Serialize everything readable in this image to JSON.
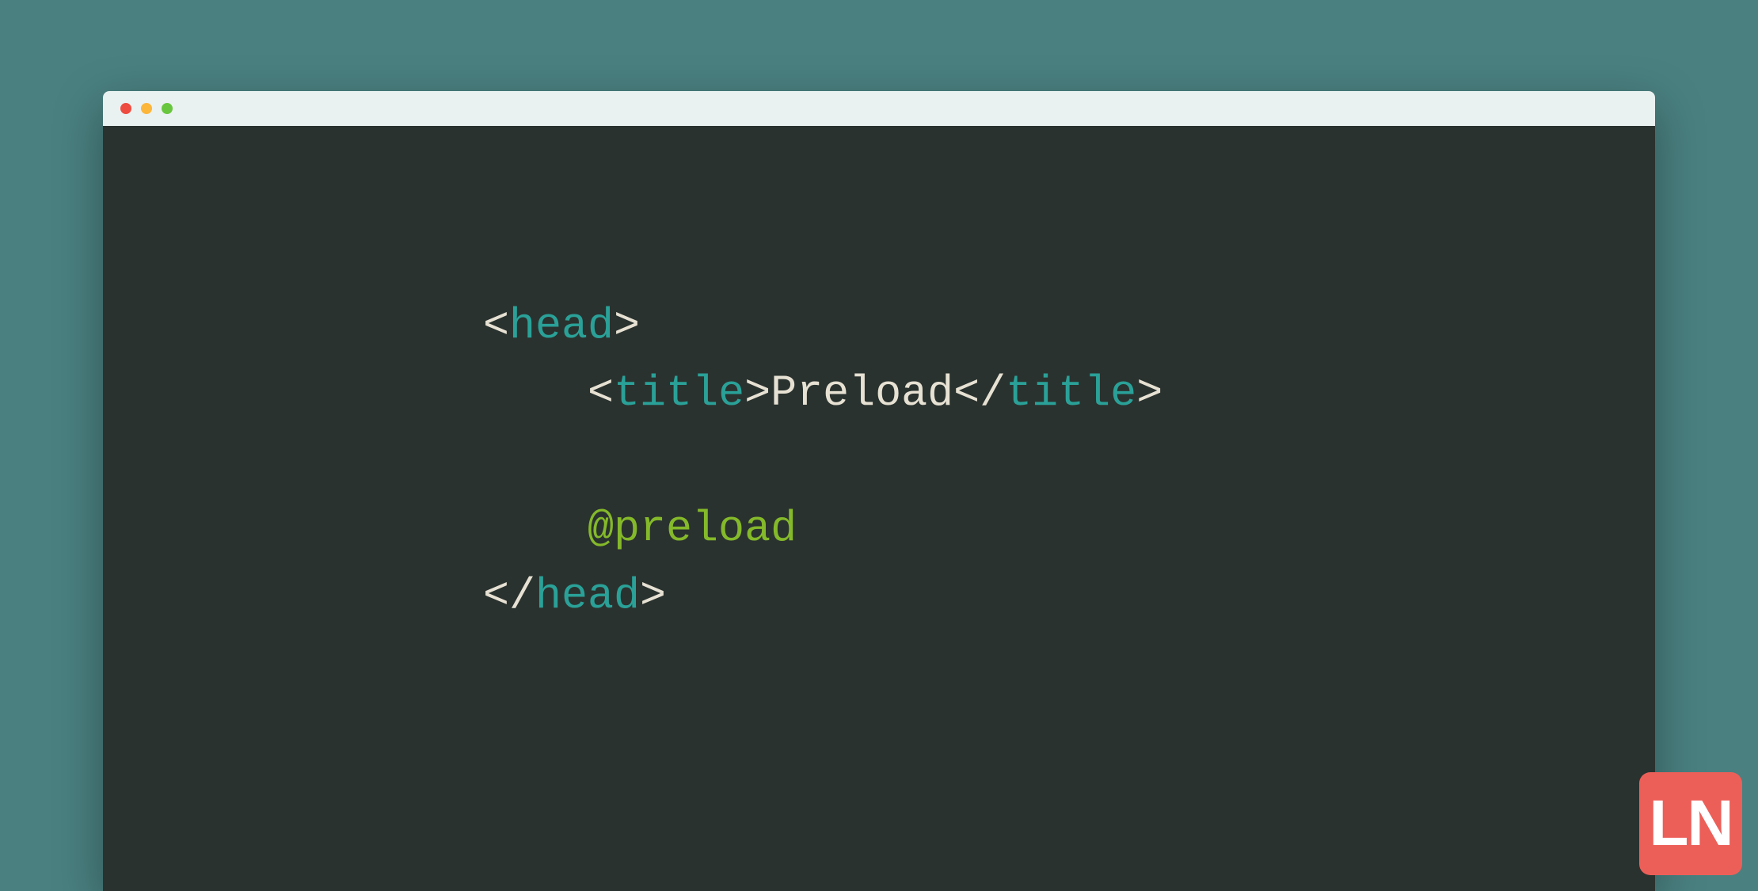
{
  "code": {
    "line1": {
      "open": "<",
      "tag": "head",
      "close": ">"
    },
    "line2": {
      "indent": "    ",
      "open1": "<",
      "tag1": "title",
      "close1": ">",
      "text": "Preload",
      "open2": "</",
      "tag2": "title",
      "close2": ">"
    },
    "line4": {
      "indent": "    ",
      "directive": "@preload"
    },
    "line5": {
      "open": "</",
      "tag": "head",
      "close": ">"
    }
  },
  "logo": "LN",
  "colors": {
    "pageBg": "#4a8080",
    "editorBg": "#2a322f",
    "titlebarBg": "#eaf1f1",
    "tagName": "#2aa198",
    "text": "#e6e1d3",
    "directive": "#84b92a",
    "logoBg": "#ec5f59"
  }
}
